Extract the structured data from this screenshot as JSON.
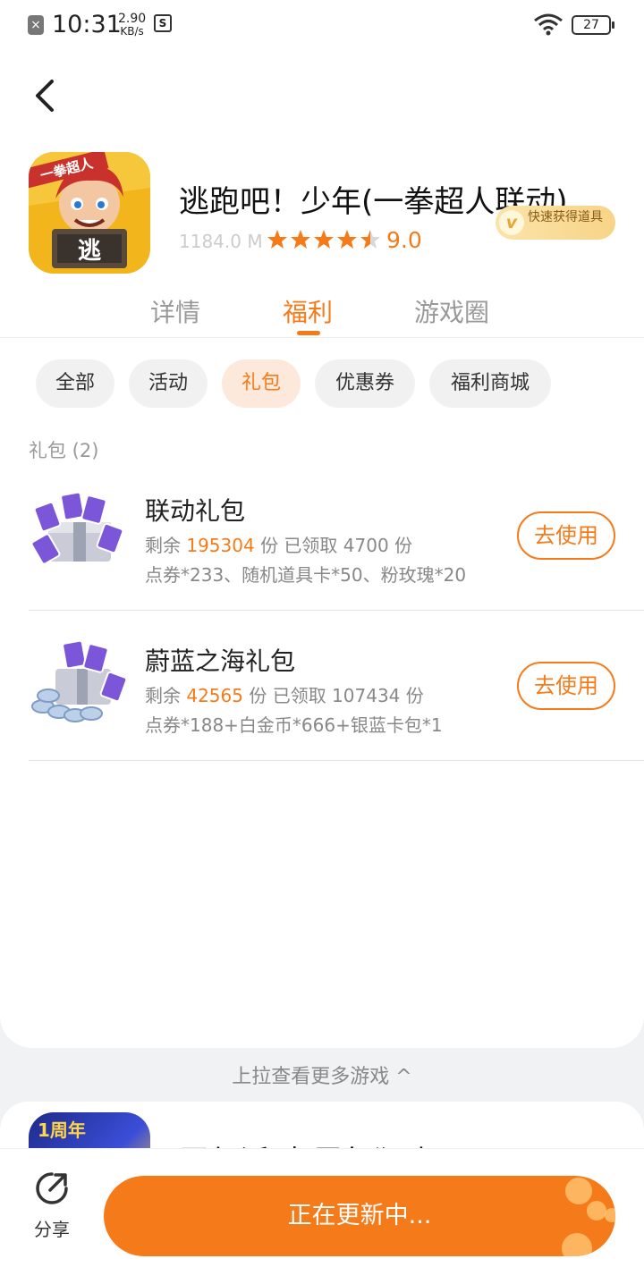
{
  "status_bar": {
    "time": "10:31",
    "net_speed_value": "2.90",
    "net_speed_unit": "KB/s",
    "battery": "27"
  },
  "app": {
    "title": "逃跑吧！少年(一拳超人联动)",
    "size": "1184.0 M",
    "rating": "9.0",
    "rating_stars": 4.5,
    "quick_badge": "快速获得道具",
    "icon_banner": "一拳超人",
    "icon_sign": "逃"
  },
  "tabs": [
    {
      "label": "详情"
    },
    {
      "label": "福利"
    },
    {
      "label": "游戏圈"
    }
  ],
  "filters": [
    {
      "label": "全部"
    },
    {
      "label": "活动"
    },
    {
      "label": "礼包"
    },
    {
      "label": "优惠券"
    },
    {
      "label": "福利商城"
    }
  ],
  "section_label": "礼包 (2)",
  "gifts": [
    {
      "title": "联动礼包",
      "remaining_prefix": "剩余",
      "remaining": "195304",
      "claimed_text": "份 已领取 4700 份",
      "contents": "点券*233、随机道具卡*50、粉玫瑰*20",
      "button": "去使用"
    },
    {
      "title": "蔚蓝之海礼包",
      "remaining_prefix": "剩余",
      "remaining": "42565",
      "claimed_text": "份 已领取 107434 份",
      "contents": "点券*188+白金币*666+银蓝卡包*1",
      "button": "去使用"
    }
  ],
  "pull_more": "上拉查看更多游戏 ^",
  "next_game": {
    "title": "蛋仔派对(周年狂欢)",
    "icon_badge": "1周年"
  },
  "bottom": {
    "share_label": "分享",
    "update_button": "正在更新中..."
  },
  "colors": {
    "accent": "#f57b1a",
    "chip_active_bg": "#fde9dc"
  }
}
